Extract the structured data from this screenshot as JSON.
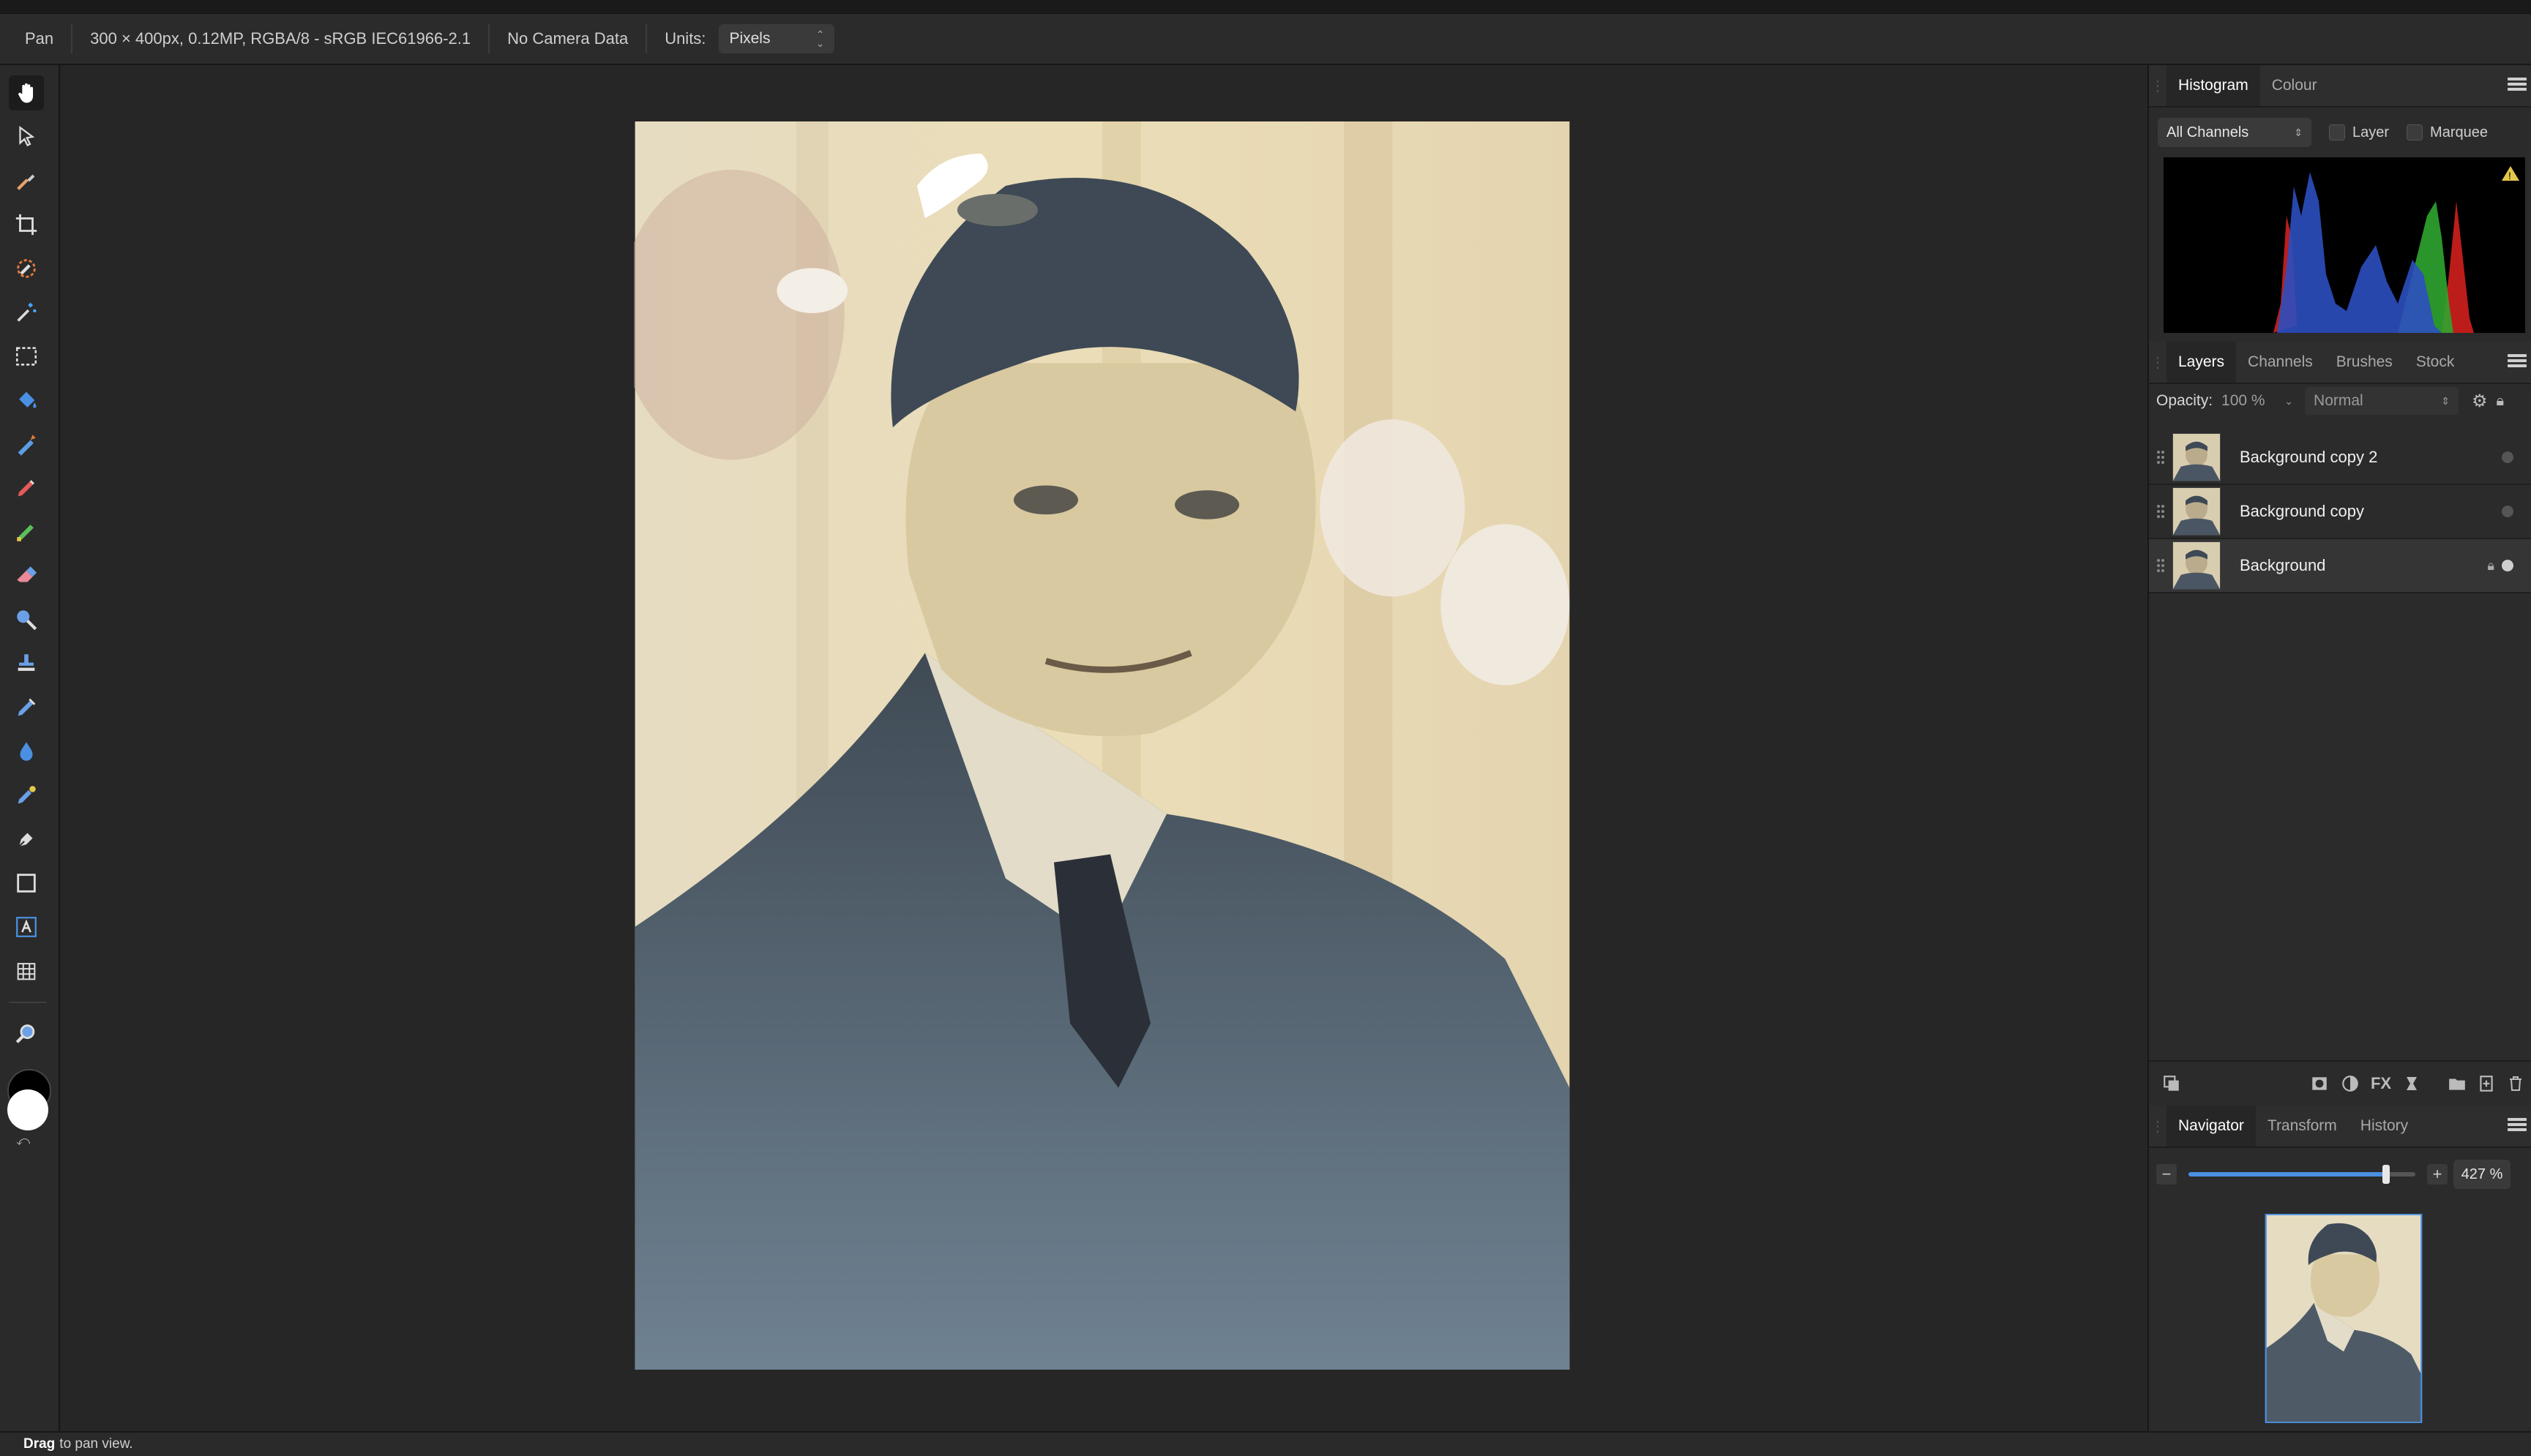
{
  "context_bar": {
    "tool_name": "Pan",
    "doc_info": "300 × 400px, 0.12MP, RGBA/8 - sRGB IEC61966-2.1",
    "camera_info": "No Camera Data",
    "units_label": "Units:",
    "units_value": "Pixels"
  },
  "toolbar": {
    "tools": [
      "hand-icon",
      "move-arrow-icon",
      "color-picker-icon",
      "crop-icon",
      "selection-brush-icon",
      "magic-wand-icon",
      "marquee-icon",
      "flood-fill-icon",
      "gradient-icon",
      "paint-brush-icon",
      "pixel-brush-icon",
      "erase-brush-icon",
      "dodge-icon",
      "clone-stamp-icon",
      "healing-brush-icon",
      "blur-icon",
      "inpaint-icon",
      "pen-icon",
      "rectangle-icon",
      "text-icon",
      "mesh-warp-icon",
      "zoom-icon"
    ],
    "active_tool": "hand-icon",
    "foreground_color": "#000000",
    "background_color": "#ffffff"
  },
  "histogram_panel": {
    "tabs": [
      "Histogram",
      "Colour"
    ],
    "active_tab": "Histogram",
    "channel_select": "All Channels",
    "layer_checkbox": "Layer",
    "marquee_checkbox": "Marquee",
    "warning_icon": "warning-triangle-icon"
  },
  "layers_panel": {
    "tabs": [
      "Layers",
      "Channels",
      "Brushes",
      "Stock"
    ],
    "active_tab": "Layers",
    "opacity_label": "Opacity:",
    "opacity_value": "100 %",
    "blend_mode": "Normal",
    "layers": [
      {
        "name": "Background copy 2",
        "locked": false,
        "visible": true
      },
      {
        "name": "Background copy",
        "locked": false,
        "visible": true
      },
      {
        "name": "Background",
        "locked": true,
        "visible": true
      }
    ]
  },
  "navigator_panel": {
    "tabs": [
      "Navigator",
      "Transform",
      "History"
    ],
    "active_tab": "Navigator",
    "zoom_value": "427 %",
    "zoom_slider_fraction": 0.87
  },
  "status_bar": {
    "action": "Drag",
    "hint": "to pan view."
  },
  "colors": {
    "accent_blue": "#4a90e2",
    "panel_bg": "#2b2b2b",
    "canvas_bg": "#262626"
  }
}
